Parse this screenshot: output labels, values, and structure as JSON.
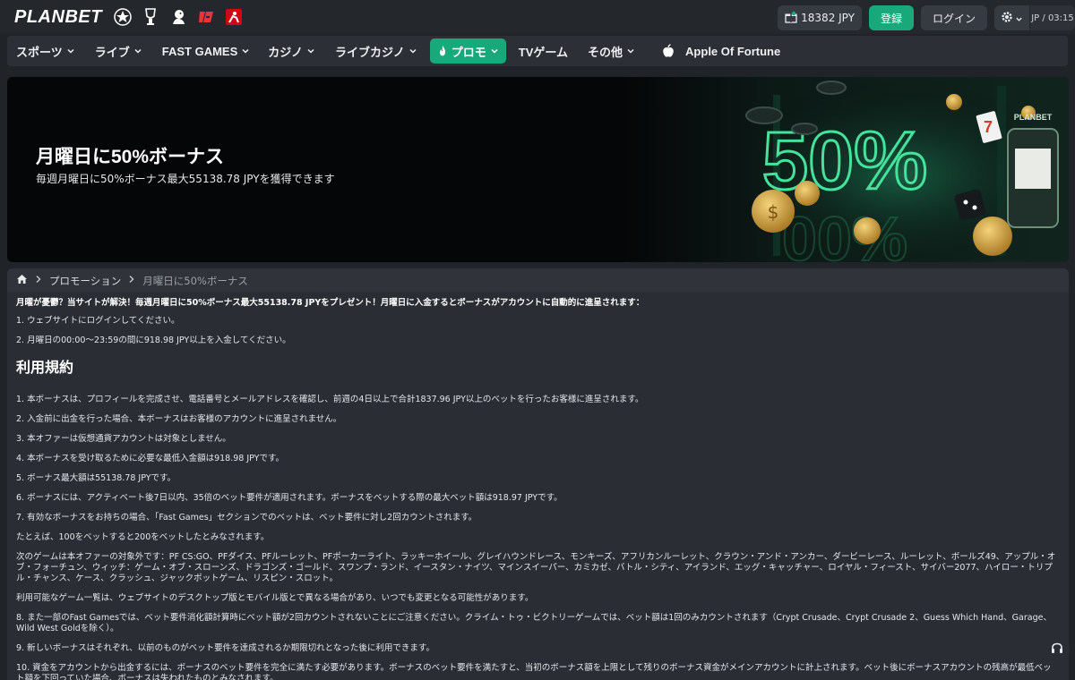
{
  "header": {
    "logo": "PLANBET",
    "leagues": [
      "champions-league-icon",
      "europa-league-icon",
      "premier-league-icon",
      "laliga-icon",
      "bundesliga-icon"
    ],
    "balance": "18382 JPY",
    "register": "登録",
    "login": "ログイン",
    "locale": "JP / 03:15"
  },
  "nav": {
    "items": [
      {
        "label": "スポーツ"
      },
      {
        "label": "ライブ"
      },
      {
        "label": "FAST GAMES"
      },
      {
        "label": "カジノ"
      },
      {
        "label": "ライブカジノ"
      },
      {
        "label": "プロモ"
      },
      {
        "label": "TVゲーム"
      },
      {
        "label": "その他"
      },
      {
        "label": "Apple Of Fortune"
      }
    ]
  },
  "banner": {
    "title": "月曜日に50%ボーナス",
    "subtitle": "毎週月曜日に50%ボーナス最大55138.78 JPYを獲得できます",
    "art_text": "50%",
    "art_brand": "PLANBET"
  },
  "breadcrumb": {
    "items": [
      "プロモーション",
      "月曜日に50%ボーナス"
    ]
  },
  "article": {
    "lead": "月曜が憂鬱？当サイトが解決！毎週月曜日に50%ボーナス最大55138.78 JPYをプレゼント！月曜日に入金するとボーナスがアカウントに自動的に進呈されます：",
    "steps": [
      "1. ウェブサイトにログインしてください。",
      "2. 月曜日の00:00～23:59の間に918.98 JPY以上を入金してください。"
    ],
    "terms_heading": "利用規約",
    "terms": [
      "1. 本ボーナスは、プロフィールを完成させ、電話番号とメールアドレスを確認し、前週の4日以上で合計1837.96 JPY以上のベットを行ったお客様に進呈されます。",
      "2. 入金前に出金を行った場合、本ボーナスはお客様のアカウントに進呈されません。",
      "3. 本オファーは仮想通貨アカウントは対象としません。",
      "4. 本ボーナスを受け取るために必要な最低入金額は918.98 JPYです。",
      "5. ボーナス最大額は55138.78 JPYです。",
      "6. ボーナスには、アクティベート後7日以内、35倍のベット要件が適用されます。ボーナスをベットする際の最大ベット額は918.97 JPYです。",
      "7. 有効なボーナスをお持ちの場合、「Fast Games」セクションでのベットは、ベット要件に対し2回カウントされます。",
      "たとえば、100をベットすると200をベットしたとみなされます。",
      "次のゲームは本オファーの対象外です：PF CS:GO、PFダイス、PFルーレット、PFポーカーライト、ラッキーホイール、グレイハウンドレース、モンキーズ、アフリカンルーレット、クラウン・アンド・アンカー、ダービーレース、ルーレット、ボールズ49、アップル・オブ・フォーチュン、ウィッチ：ゲーム・オブ・スローンズ、ドラゴンズ・ゴールド、スワンプ・ランド、イースタン・ナイツ、マインスイーパー、カミカゼ、バトル・シティ、アイランド、エッグ・キャッチャー、ロイヤル・フィースト、サイバー2077、ハイロー・トリプル・チャンス、ケース、クラッシュ、ジャックポットゲーム、リスピン・スロット。",
      "利用可能なゲーム一覧は、ウェブサイトのデスクトップ版とモバイル版とで異なる場合があり、いつでも変更となる可能性があります。",
      "8. また一部のFast Gamesでは、ベット要件消化額計算時にベット額が2回カウントされないことにご注意ください。クライム・トゥ・ビクトリーゲームでは、ベット額は1回のみカウントされます（Crypt Crusade、Crypt Crusade 2、Guess Which Hand、Garage、Wild West Goldを除く）。",
      "9. 新しいボーナスはそれぞれ、以前のものがベット要件を達成されるか期限切れとなった後に利用できます。",
      "10. 資金をアカウントから出金するには、ボーナスのベット要件を完全に満たす必要があります。ボーナスのベット要件を満たすと、当初のボーナス額を上限として残りのボーナス資金がメインアカウントに計上されます。ベット後にボーナスアカウントの残高が最低ベット額を下回っていた場合、ボーナスは失われたものとみなされます。"
    ]
  },
  "colors": {
    "accent": "#18a87a",
    "background": "#202328",
    "panel": "#2a2d33"
  }
}
